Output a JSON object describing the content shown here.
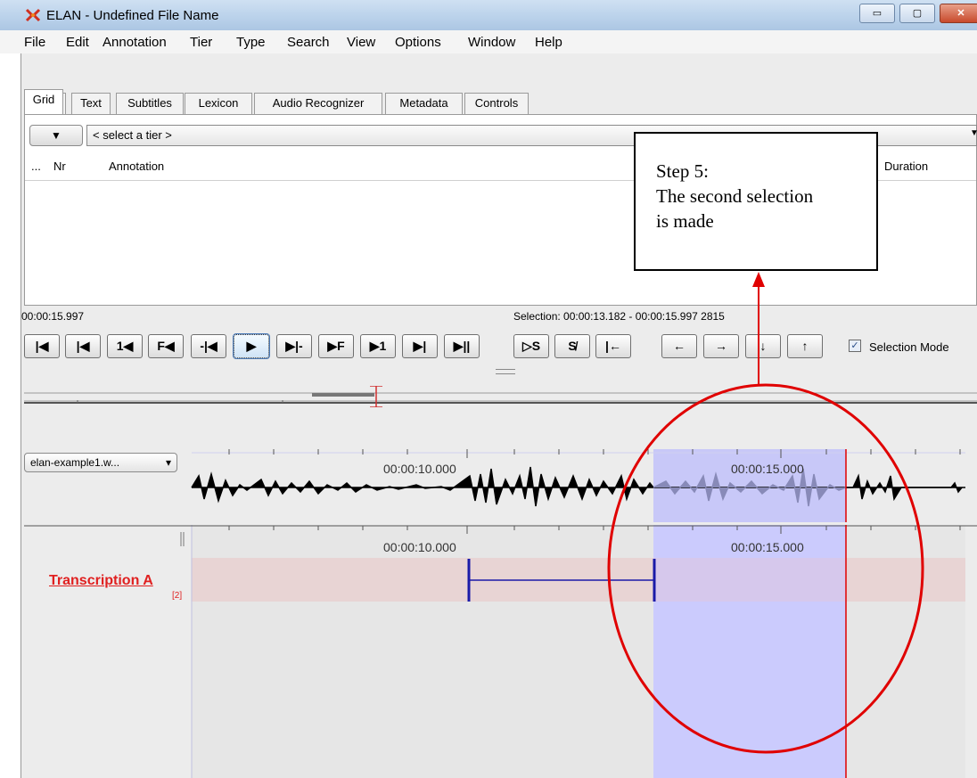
{
  "window": {
    "title": "ELAN - Undefined File Name",
    "min": "▭",
    "max": "▢",
    "close": "✕"
  },
  "menu": [
    "File",
    "Edit",
    "Annotation",
    "Tier",
    "Type",
    "Search",
    "View",
    "Options",
    "Window",
    "Help"
  ],
  "tabs": [
    "Grid",
    "Text",
    "Subtitles",
    "Lexicon",
    "Audio Recognizer",
    "Metadata",
    "Controls"
  ],
  "grid": {
    "dropdown_arrow": "▼",
    "tier_placeholder": "< select a tier >",
    "columns": {
      "more": "...",
      "nr": "Nr",
      "annotation": "Annotation",
      "duration": "Duration"
    }
  },
  "callout": {
    "line1": "Step 5:",
    "line2": "The second selection",
    "line3": "is made"
  },
  "player": {
    "current_time": "00:00:15.997",
    "selection": "Selection: 00:00:13.182 - 00:00:15.997  2815",
    "selection_mode_label": "Selection Mode",
    "selection_mode_checked": true,
    "buttons": [
      "|◀",
      "|◀",
      "1◀",
      "F◀",
      "-|◀",
      "▶",
      "▶|-",
      "▶F",
      "▶1",
      "▶|",
      "▶||"
    ],
    "sel_buttons": [
      "▷S",
      "S̸",
      "|←",
      "←",
      "→",
      "↓",
      "↑"
    ]
  },
  "media": {
    "file": "elan-example1.w...",
    "arrow": "▾"
  },
  "timeline": {
    "label_10": "00:00:10.000",
    "label_15": "00:00:15.000"
  },
  "tier": {
    "name": "Transcription A",
    "count": "[2]"
  },
  "colors": {
    "selection": "#c8c8ff",
    "cursor": "#e00000",
    "annotation_line": "#1a1aa8",
    "tier_band": "#e8d4d4",
    "ellipse": "#e00000"
  }
}
